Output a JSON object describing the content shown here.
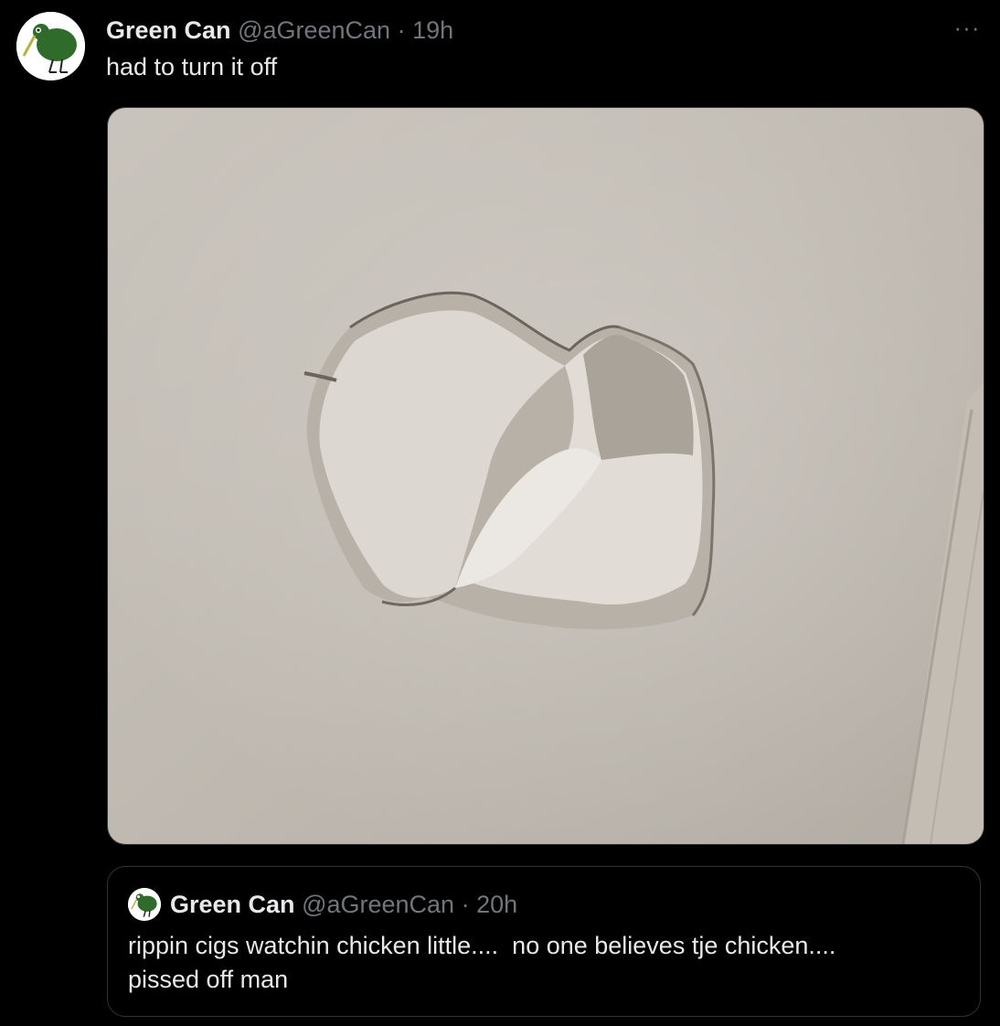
{
  "tweet": {
    "author_name": "Green Can",
    "author_handle": "@aGreenCan",
    "separator": "·",
    "time": "19h",
    "text": "had to turn it off",
    "more_icon": "more-horizontal-icon",
    "media_alt_description": "photo of a hole punched in a wall"
  },
  "quoted_tweet": {
    "author_name": "Green Can",
    "author_handle": "@aGreenCan",
    "separator": "·",
    "time": "20h",
    "text_line1": "rippin cigs watchin chicken little....  no one believes tje chicken....",
    "text_line2": "pissed off man"
  },
  "colors": {
    "background": "#000000",
    "text_primary": "#e7e9ea",
    "text_secondary": "#71767b",
    "border": "#2f3336",
    "avatar_bird": "#2f6b2a"
  }
}
